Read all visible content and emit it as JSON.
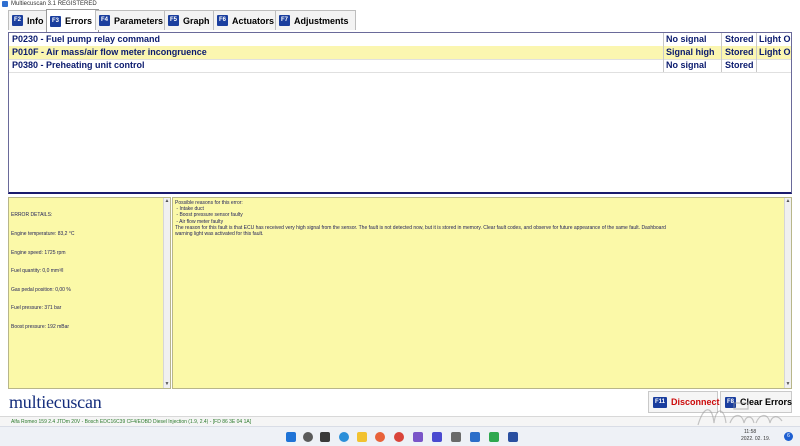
{
  "window": {
    "title": "Multiecuscan 3.1 REGISTERED"
  },
  "tabs": [
    {
      "key": "F2",
      "label": "Info",
      "active": false
    },
    {
      "key": "F3",
      "label": "Errors",
      "active": true
    },
    {
      "key": "F4",
      "label": "Parameters",
      "active": false
    },
    {
      "key": "F5",
      "label": "Graph",
      "active": false
    },
    {
      "key": "F6",
      "label": "Actuators",
      "active": false
    },
    {
      "key": "F7",
      "label": "Adjustments",
      "active": false
    }
  ],
  "errors": [
    {
      "code": "P0230 - Fuel pump relay command",
      "signal": "No signal",
      "status": "Stored",
      "light": "Light ON"
    },
    {
      "code": "P010F - Air mass/air flow meter incongruence",
      "signal": "Signal high",
      "status": "Stored",
      "light": "Light ON"
    },
    {
      "code": "P0380 - Preheating unit control",
      "signal": "No signal",
      "status": "Stored",
      "light": ""
    }
  ],
  "error_details": {
    "lines": [
      "ERROR DETAILS:",
      "Engine temperature: 83,2 °C",
      "Engine speed: 1725 rpm",
      "Fuel quantity: 0,0 mm³/I",
      "Gas pedal position: 0,00 %",
      "Fuel pressure: 371 bar",
      "Boost pressure: 192 mBar"
    ]
  },
  "reasons": {
    "lines": [
      "Possible reasons for this error:",
      " - Intake duct",
      " - Boost pressure sensor faulty",
      " - Air flow meter faulty",
      "The reason for this fault is that ECU has received very high signal from the sensor. The fault is not detected now, but it is stored in memory. Clear fault codes, and observe for future appearance of the same fault. Dashboard",
      "warning light was activated for this fault."
    ]
  },
  "branding": {
    "logo_text": "multiecuscan"
  },
  "buttons": {
    "disconnect": {
      "key": "F11",
      "label": "Disconnect"
    },
    "clear": {
      "key": "F8",
      "label": "Clear Errors"
    }
  },
  "statusbar": {
    "text": "Alfa Romeo 159 2.4 JTDm 20V - Bosch EDC16C39 CF4/EOBD Diesel Injection (1.9, 2.4) - [FD 86 3E 04 1A]"
  },
  "taskbar": {
    "time": "11:58",
    "date": "2022. 02. 19.",
    "notification_count": "6"
  },
  "colors": {
    "tab_key_bg": "#1a3e9e",
    "error_text": "#0a1a6e",
    "selected_row": "#fbf6b0",
    "details_bg": "#fbf9a8",
    "disconnect_text": "#cc0a0a",
    "logo_text": "#132c7c",
    "status_text": "#2c7a2c"
  }
}
